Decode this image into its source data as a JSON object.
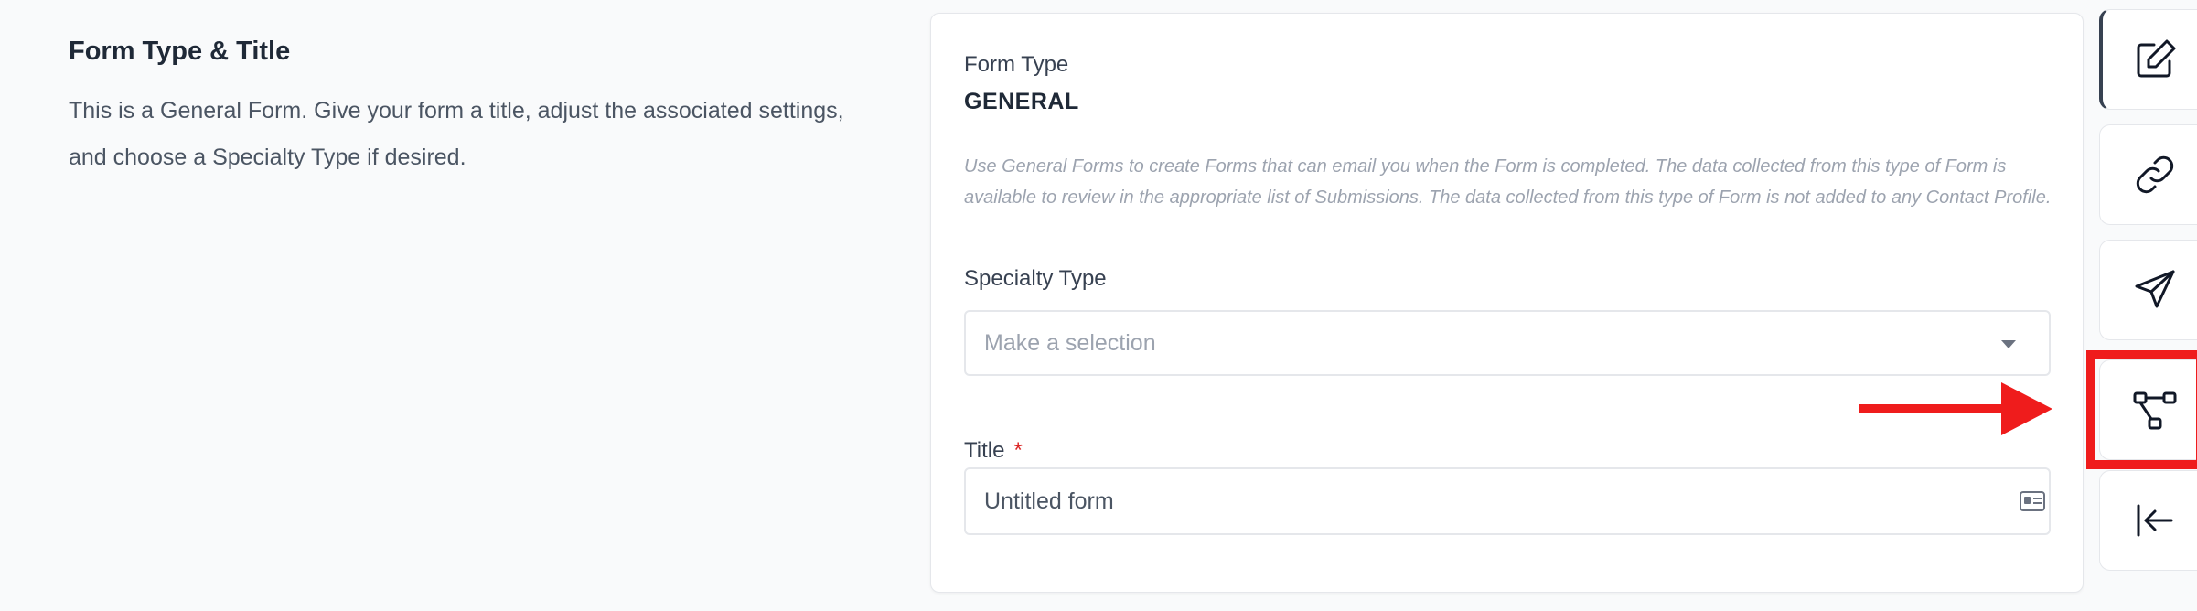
{
  "intro": {
    "title": "Form Type & Title",
    "description": "This is a General Form. Give your form a title, adjust the associated settings, and choose a Specialty Type if desired."
  },
  "form": {
    "type_label": "Form Type",
    "type_value": "GENERAL",
    "help_text": "Use General Forms to create Forms that can email you when the Form is completed. The data collected from this type of Form is available to review in the appropriate list of Submissions. The data collected from this type of Form is not added to any Contact Profile.",
    "specialty_label": "Specialty Type",
    "specialty_placeholder": "Make a selection",
    "title_label": "Title",
    "title_required_mark": "*",
    "title_value": "Untitled form"
  },
  "rail": {
    "items": [
      {
        "name": "edit",
        "icon": "edit-icon",
        "active": true
      },
      {
        "name": "link",
        "icon": "link-icon",
        "active": false
      },
      {
        "name": "send",
        "icon": "paper-plane-icon",
        "active": false
      },
      {
        "name": "workflow",
        "icon": "workflow-icon",
        "active": false,
        "highlighted": true
      },
      {
        "name": "collapse",
        "icon": "collapse-left-icon",
        "active": false
      }
    ]
  },
  "colors": {
    "highlight": "#ef1c1c",
    "required": "#dc2626",
    "text_primary": "#1f2937",
    "text_muted": "#9ca3af"
  }
}
